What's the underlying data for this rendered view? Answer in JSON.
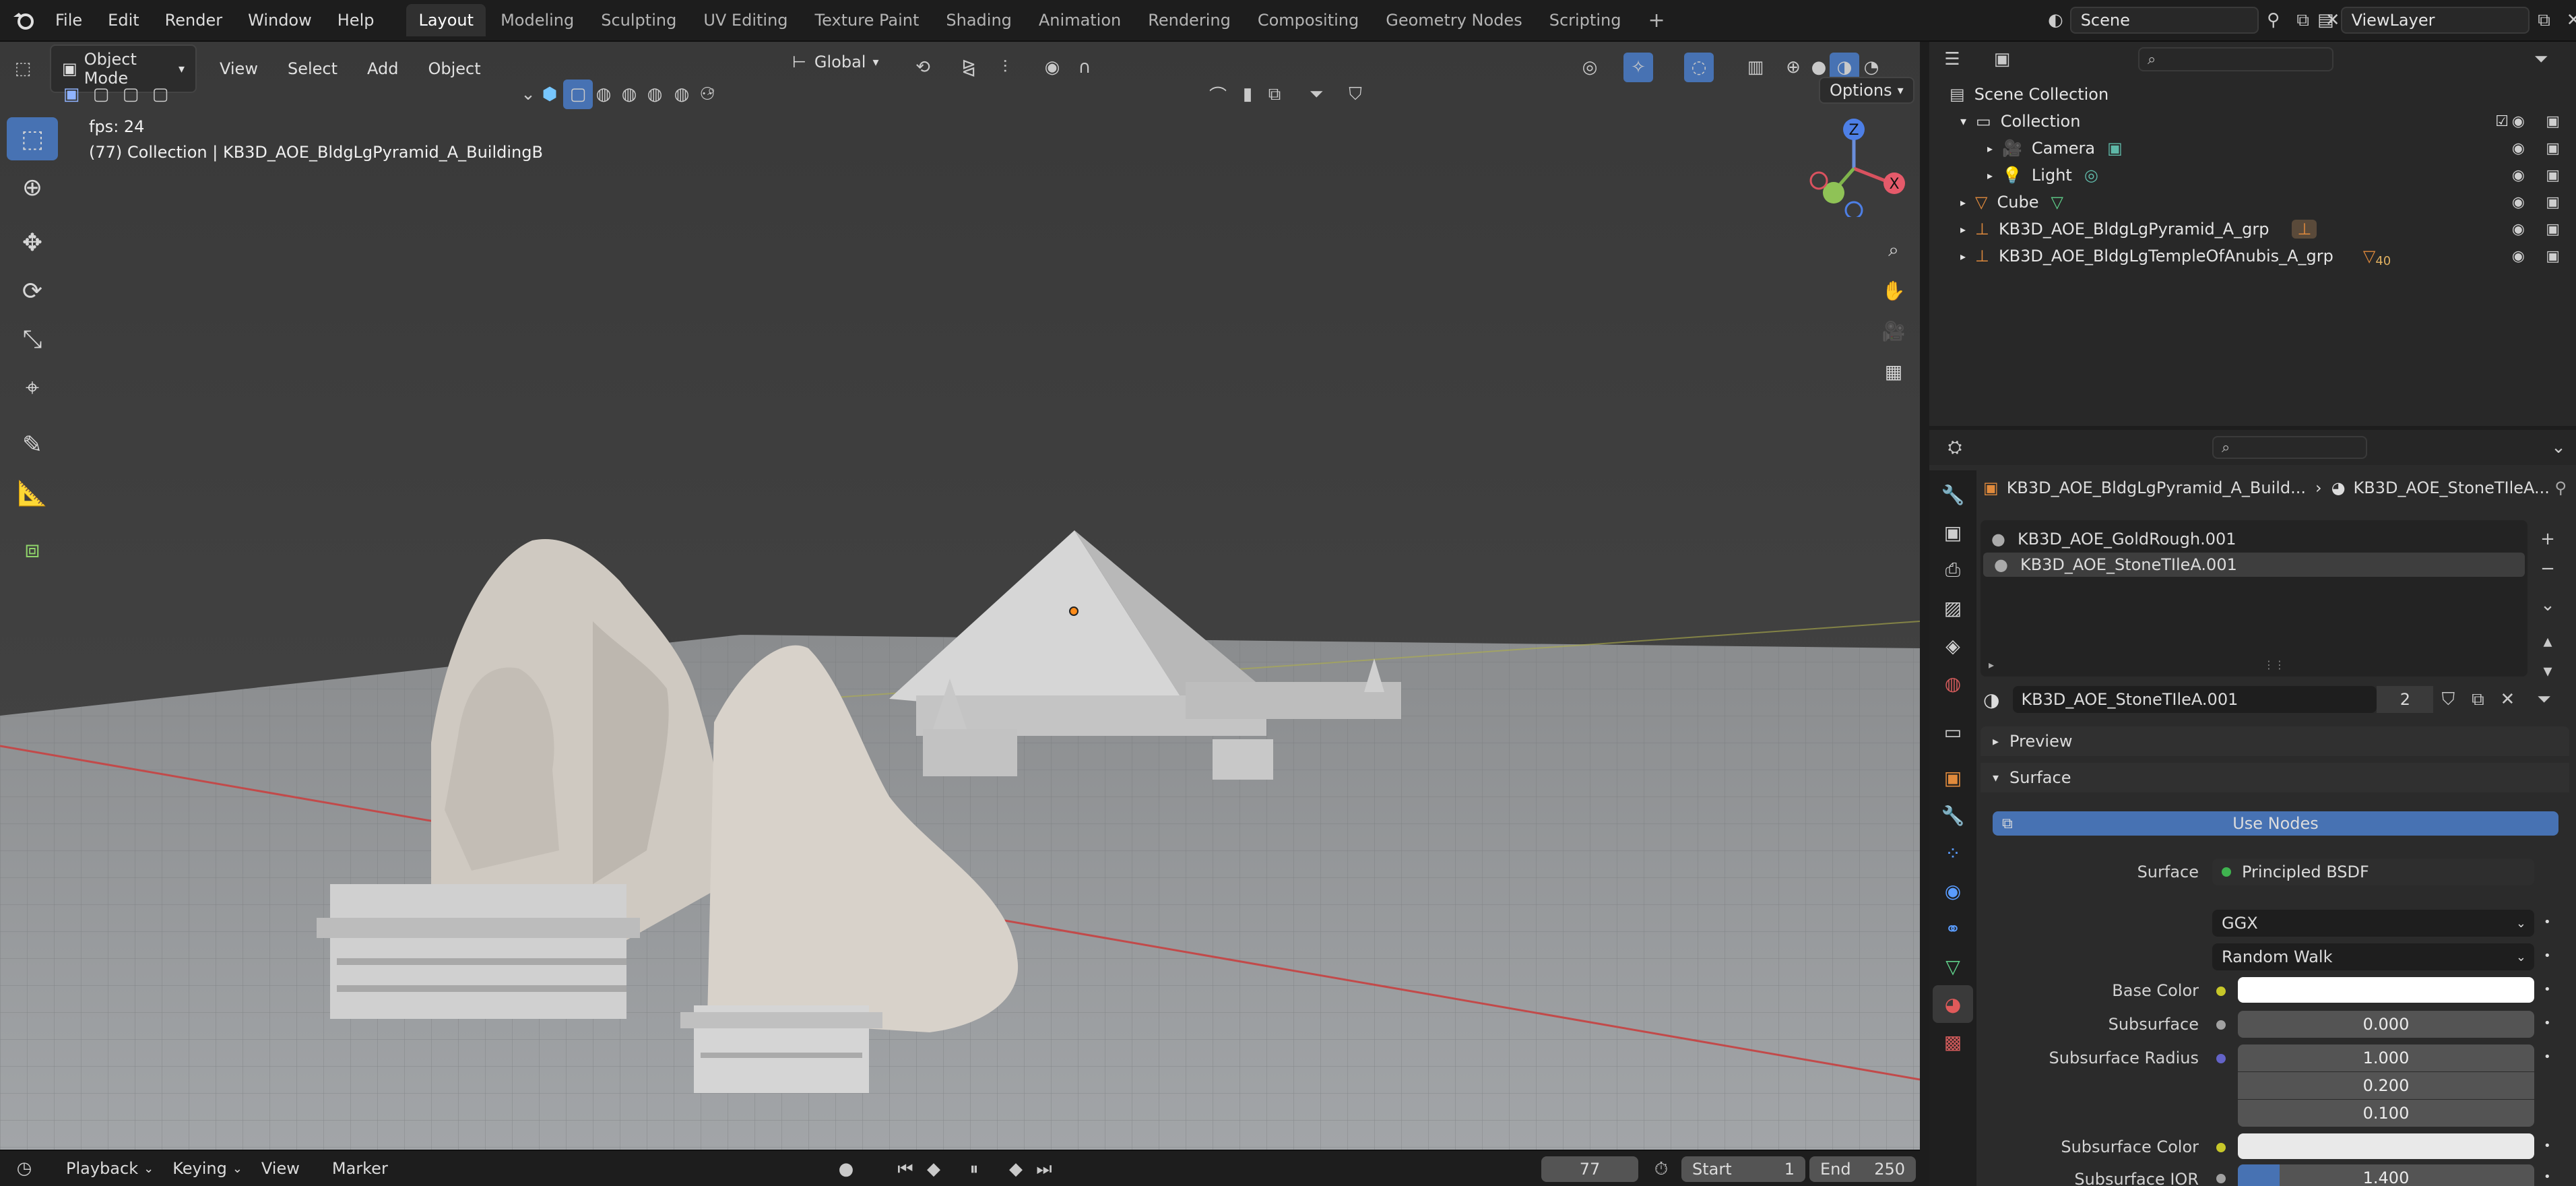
{
  "menubar": {
    "items": [
      "File",
      "Edit",
      "Render",
      "Window",
      "Help"
    ],
    "workspaces": [
      "Layout",
      "Modeling",
      "Sculpting",
      "UV Editing",
      "Texture Paint",
      "Shading",
      "Animation",
      "Rendering",
      "Compositing",
      "Geometry Nodes",
      "Scripting"
    ],
    "active_workspace": "Layout",
    "add_workspace": "+",
    "scene_label": "Scene",
    "viewlayer_label": "ViewLayer"
  },
  "viewport": {
    "mode": "Object Mode",
    "menus": [
      "View",
      "Select",
      "Add",
      "Object"
    ],
    "transform_orientation": "Global",
    "options_label": "Options",
    "overlay_text_fps": "fps: 24",
    "overlay_text_collection": "(77) Collection | KB3D_AOE_BldgLgPyramid_A_BuildingB",
    "gizmo_z": "Z",
    "gizmo_x": "X"
  },
  "outliner": {
    "title": "Scene Collection",
    "rows": [
      {
        "label": "Collection",
        "indent": 1
      },
      {
        "label": "Camera",
        "indent": 2
      },
      {
        "label": "Light",
        "indent": 2
      },
      {
        "label": "Cube",
        "indent": 1
      },
      {
        "label": "KB3D_AOE_BldgLgPyramid_A_grp",
        "indent": 1
      },
      {
        "label": "KB3D_AOE_BldgLgTempleOfAnubis_A_grp",
        "indent": 1
      }
    ],
    "badge_40": "40"
  },
  "properties": {
    "breadcrumb_object": "KB3D_AOE_BldgLgPyramid_A_Build...",
    "breadcrumb_material": "KB3D_AOE_StoneTIleA...",
    "slots": [
      "KB3D_AOE_GoldRough.001",
      "KB3D_AOE_StoneTIleA.001"
    ],
    "material_name": "KB3D_AOE_StoneTIleA.001",
    "material_users": "2",
    "panel_preview": "Preview",
    "panel_surface": "Surface",
    "use_nodes": "Use Nodes",
    "surface_label": "Surface",
    "surface_value": "Principled BSDF",
    "distribution": "GGX",
    "subsurface_method": "Random Walk",
    "base_color_label": "Base Color",
    "subsurface_label": "Subsurface",
    "subsurface_value": "0.000",
    "subsurface_radius_label": "Subsurface Radius",
    "radius_1": "1.000",
    "radius_2": "0.200",
    "radius_3": "0.100",
    "subsurface_color_label": "Subsurface Color",
    "subsurface_ior_label": "Subsurface IOR",
    "subsurface_ior_value": "1.400",
    "subsurface_ior_fill": 0.14
  },
  "timeline": {
    "menus": [
      "Playback",
      "Keying",
      "View",
      "Marker"
    ],
    "current_frame": "77",
    "start_label": "Start",
    "start_value": "1",
    "end_label": "End",
    "end_value": "250"
  },
  "colors": {
    "accent": "#4772b3",
    "viewport_bg": "#3a3a3a",
    "panel_bg": "#2b2b2b"
  }
}
